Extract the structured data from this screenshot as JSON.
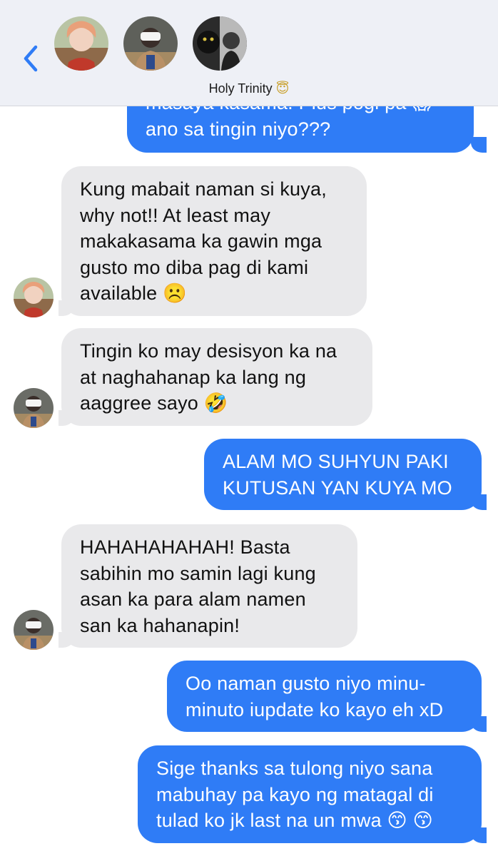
{
  "header": {
    "group_name": "Holy Trinity",
    "group_emoji": "😇"
  },
  "messages": [
    {
      "direction": "out",
      "lines": [
        "masaya kasama. Plus pogi pa 😱",
        "ano sa tingin niyo???"
      ]
    },
    {
      "direction": "in",
      "sender": "avatar-1",
      "lines": [
        "Kung mabait naman si kuya,",
        "why not!! At least may",
        "makakasama ka gawin mga",
        "gusto mo diba pag di kami",
        "available ☹️"
      ]
    },
    {
      "direction": "in",
      "sender": "avatar-2",
      "lines": [
        "Tingin ko may desisyon ka na",
        "at naghahanap ka lang ng",
        "aaggree sayo 🤣"
      ]
    },
    {
      "direction": "out",
      "lines": [
        "ALAM MO SUHYUN PAKI",
        "KUTUSAN YAN KUYA MO"
      ]
    },
    {
      "direction": "in",
      "sender": "avatar-2",
      "lines": [
        "HAHAHAHAHAH! Basta",
        "sabihin mo samin lagi kung",
        "asan ka para alam namen",
        "san ka hahanapin!"
      ]
    },
    {
      "direction": "out",
      "lines": [
        "Oo naman gusto niyo minu-",
        "minuto iupdate ko kayo eh xD"
      ]
    },
    {
      "direction": "out",
      "lines": [
        "Sige thanks sa tulong niyo sana",
        "mabuhay pa kayo ng matagal di",
        "tulad ko jk last na un mwa 😙 😙"
      ]
    }
  ]
}
